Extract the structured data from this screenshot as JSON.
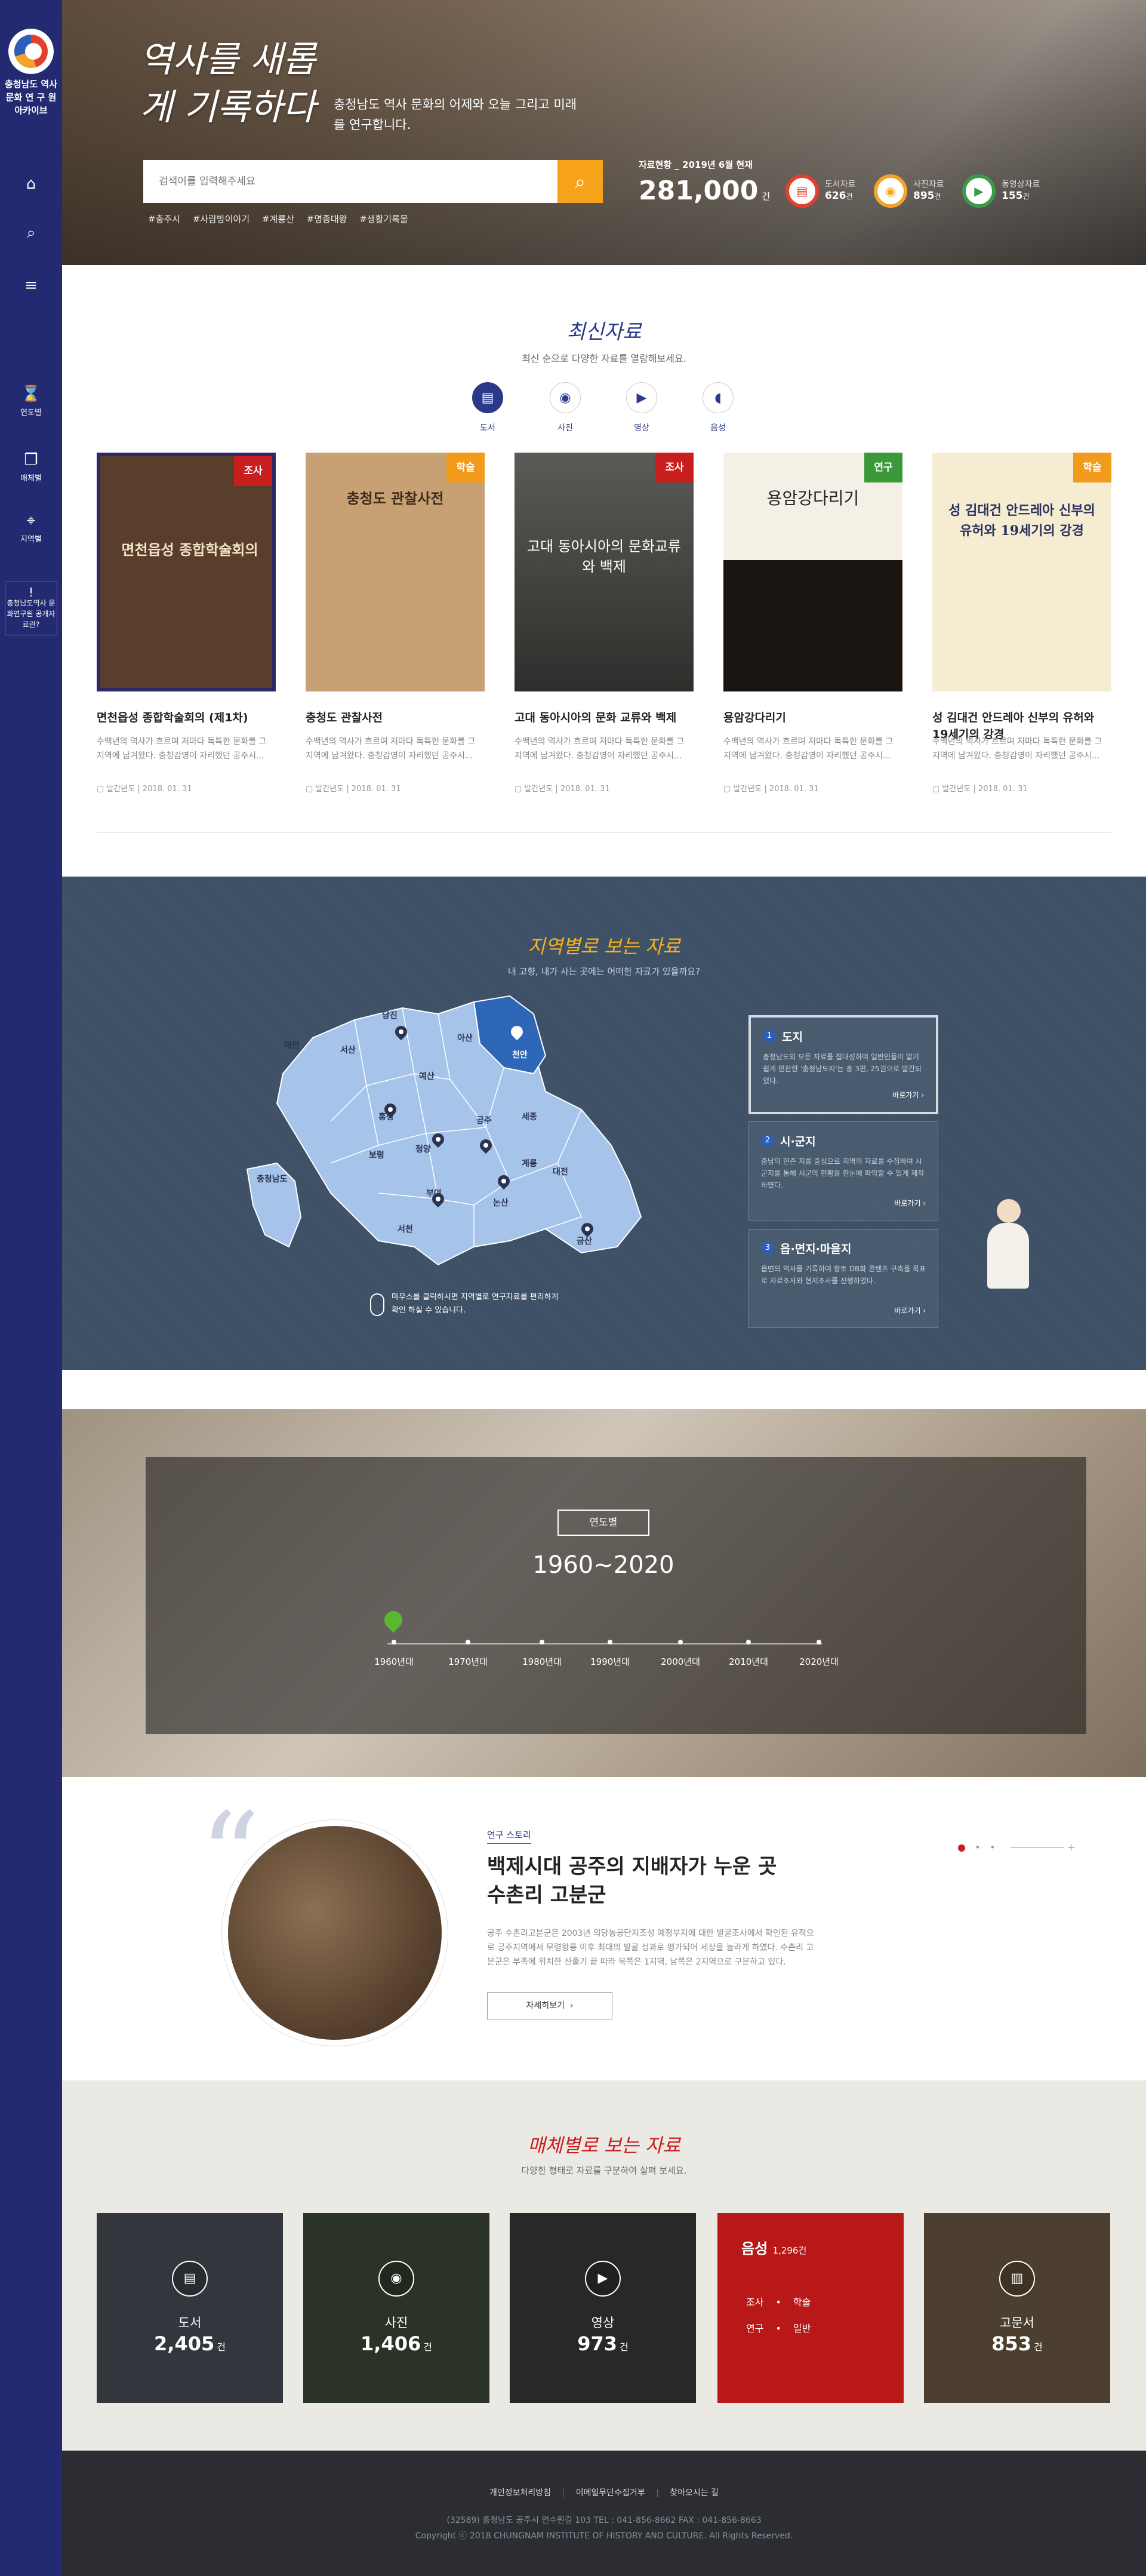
{
  "sidebar": {
    "org_name": "충청남도 역사문화 연 구 원 아카이브",
    "nav": [
      {
        "label": "연도별"
      },
      {
        "label": "매체별"
      },
      {
        "label": "지역별"
      }
    ],
    "special": "충청남도역사 문화연구원 공개자료란?"
  },
  "hero": {
    "calligraphy": "역사를 새롭게 기록하다",
    "subtitle": "충청남도 역사 문화의 어제와 오늘 그리고 미래를 연구합니다.",
    "search_placeholder": "검색어를 입력해주세요",
    "tags": [
      "#충주시",
      "#사람방이야기",
      "#계룡산",
      "#명종대왕",
      "#생활기록물"
    ],
    "stats_head": "자료현황 _ 2019년 6월 현재",
    "total": "281,000",
    "total_unit": "건",
    "stats": [
      {
        "label": "도서자료",
        "value": "626",
        "unit": "건",
        "color": "#e14030",
        "icon": "book-icon"
      },
      {
        "label": "사진자료",
        "value": "895",
        "unit": "건",
        "color": "#f2a32a",
        "icon": "camera-icon"
      },
      {
        "label": "동영상자료",
        "value": "155",
        "unit": "건",
        "color": "#3a9a4a",
        "icon": "play-icon"
      }
    ]
  },
  "latest": {
    "title": "최신자료",
    "desc": "최신 순으로 다양한 자료를 열람해보세요.",
    "tabs": [
      {
        "label": "도서",
        "icon": "book-icon"
      },
      {
        "label": "사진",
        "icon": "camera-icon"
      },
      {
        "label": "영상",
        "icon": "play-icon"
      },
      {
        "label": "음성",
        "icon": "audio-icon"
      }
    ],
    "cards": [
      {
        "badge": "조사",
        "badge_color": "#c81e1e",
        "cover": "면천읍성 종합학술회의",
        "bg": "#5a3e2c",
        "title": "면천읍성 종합학술회의 (제1차)",
        "desc": "수백년의 역사가 흐르며 저마다 독특한 문화를 그 지역에 남겨왔다. 충청감영이 자리했던 공주시...",
        "source": "발간년도",
        "date": "2018. 01. 31"
      },
      {
        "badge": "학술",
        "badge_color": "#f29a1a",
        "cover": "충청도 관찰사전",
        "bg": "#c7a074",
        "title": "충청도 관찰사전",
        "desc": "수백년의 역사가 흐르며 저마다 독특한 문화를 그 지역에 남겨왔다. 충청감영이 자리했던 공주시...",
        "source": "발간년도",
        "date": "2018. 01. 31"
      },
      {
        "badge": "조사",
        "badge_color": "#c81e1e",
        "cover": "고대 동아시아의 문화교류와 백제",
        "bg": "#3a3a38",
        "title": "고대 동아시아의 문화 교류와 백제",
        "desc": "수백년의 역사가 흐르며 저마다 독특한 문화를 그 지역에 남겨왔다. 충청감영이 자리했던 공주시...",
        "source": "발간년도",
        "date": "2018. 01. 31"
      },
      {
        "badge": "연구",
        "badge_color": "#3a9a3a",
        "cover": "용암강다리기",
        "bg": "#f5f0e6",
        "title": "용암강다리기",
        "desc": "수백년의 역사가 흐르며 저마다 독특한 문화를 그 지역에 남겨왔다. 충청감영이 자리했던 공주시...",
        "source": "발간년도",
        "date": "2018. 01. 31"
      },
      {
        "badge": "학술",
        "badge_color": "#f29a1a",
        "cover": "성 김대건 안드레아 신부의 유허와 19세기의 강경",
        "bg": "#f6ecd2",
        "title": "성 김대건 안드레아 신부의 유허와 19세기의 강경",
        "desc": "수백년의 역사가 흐르며 저마다 독특한 문화를 그 지역에 남겨왔다. 충청감영이 자리했던 공주시...",
        "source": "발간년도",
        "date": "2018. 01. 31"
      }
    ]
  },
  "region": {
    "title": "지역별로 보는 자료",
    "desc": "내 고향, 내가 사는 곳에는 어떠한 자료가 있을까요?",
    "map_labels": [
      "당진",
      "서산",
      "아산",
      "천안",
      "태안",
      "예산",
      "홍성",
      "청양",
      "공주",
      "세종",
      "보령",
      "부여",
      "계룡",
      "대전",
      "논산",
      "서천",
      "금산",
      "충청남도"
    ],
    "hint": "마우스를 클릭하시면 지역별로 연구자료를 편리하게 확인 하실 수 있습니다.",
    "cards": [
      {
        "num": "1",
        "title": "도지",
        "desc": "충청남도의 모든 자료를 집대성하여 일반인들이 알기 쉽게 편찬한 '충청남도지'는 총 3편, 25권으로 발간되었다.",
        "more": "바로가기"
      },
      {
        "num": "2",
        "title": "시·군지",
        "desc": "충남의 현존 지를 중심으로 지역의 자료를 수집하여 시군지를 통해 시군의 현황을 한눈에 파악할 수 있게 제작하였다.",
        "more": "바로가기"
      },
      {
        "num": "3",
        "title": "읍·면지·마을지",
        "desc": "읍면의 역사를 기록하여 향토 DB화 콘텐츠 구축을 목표로 자료조사와 현지조사를 진행하였다.",
        "more": "바로가기"
      }
    ]
  },
  "year": {
    "label": "연도별",
    "range": "1960~2020",
    "ticks": [
      "1960년대",
      "1970년대",
      "1980년대",
      "1990년대",
      "2000년대",
      "2010년대",
      "2020년대"
    ]
  },
  "story": {
    "badge": "연구 스토리",
    "title_line1": "백제시대 공주의 지배자가 누운 곳",
    "title_line2": "수촌리 고분군",
    "text": "공주 수촌리고분군은 2003년 의당농공단지조성 예정부지에 대한 발굴조사에서 확인된 유적으로 공주지역에서 무령왕릉 이후 최대의 발굴 성과로 평가되어 세상을 놀라게 하였다. 수촌리 고분군은 부족에 위치한 산줄기 끝 따라 북쪽은 1지역, 남쪽은 2지역으로 구분하고 있다.",
    "more": "자세히보기"
  },
  "format": {
    "title": "매체별로 보는 자료",
    "desc": "다양한 형태로 자료를 구분하여 살펴 보세요.",
    "cards": [
      {
        "name": "도서",
        "count": "2,405",
        "unit": "건",
        "icon": "book-icon",
        "bg": "#5d6470"
      },
      {
        "name": "사진",
        "count": "1,406",
        "unit": "건",
        "icon": "camera-icon",
        "bg": "#4f5d46"
      },
      {
        "name": "영상",
        "count": "973",
        "unit": "건",
        "icon": "play-icon",
        "bg": "#4a4a4a"
      },
      {
        "name": "고문서",
        "count": "853",
        "unit": "건",
        "icon": "book-icon",
        "bg": "#8a7456"
      }
    ],
    "sound": {
      "name": "음성",
      "count": "1,296",
      "unit": "건",
      "items": [
        "조사",
        "학술",
        "연구",
        "일반"
      ],
      "color": "#b81818"
    }
  },
  "footer": {
    "links": [
      "개인정보처리방침",
      "이메일무단수집거부",
      "찾아오시는 길"
    ],
    "address": "(32589) 충청남도 공주시 연수원길 103 TEL : 041-856-8662 FAX : 041-856-8663",
    "copyright": "Copyright ⓒ 2018 CHUNGNAM INSTITUTE OF HISTORY AND CULTURE. All Rights Reserved."
  }
}
